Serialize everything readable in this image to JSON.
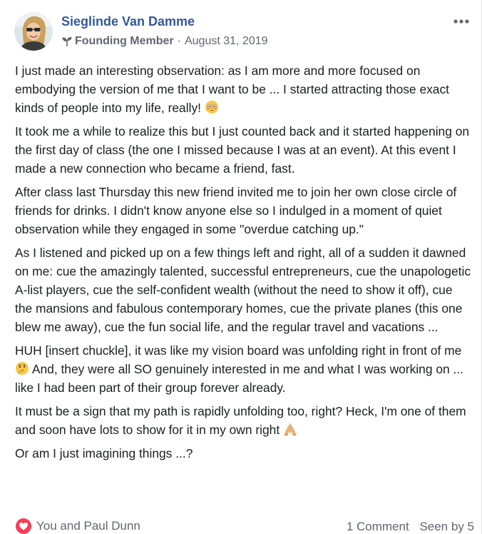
{
  "post": {
    "author": {
      "name": "Sieglinde Van Damme",
      "badge": "Founding Member",
      "date": "August 31, 2019"
    },
    "paragraphs": [
      {
        "text": "I just made an interesting observation: as I am more and more focused on embodying the version of me that I want to be ... I started attracting those exact kinds of people into my life, really! ",
        "emoji": "flushed-face-emoji",
        "after": ""
      },
      {
        "text": "It took me a while to realize this but I just counted back and it started happening on the first day of class (the one I missed because I was at an event). At this event I made a new connection who became a friend, fast.",
        "emoji": "",
        "after": ""
      },
      {
        "text": "After class last Thursday this new friend invited me to join her own close circle of friends for drinks. I didn't know anyone else so I indulged in a moment of quiet observation while they engaged in some \"overdue catching up.\"",
        "emoji": "",
        "after": ""
      },
      {
        "text": "As I listened and picked up on a few things left and right, all of a sudden it dawned on me: cue the amazingly talented, successful entrepreneurs, cue the unapologetic A-list players, cue the self-confident wealth (without the need to show it off), cue the mansions and fabulous contemporary homes, cue the private planes (this one blew me away), cue the fun social life, and the regular travel and vacations ...",
        "emoji": "",
        "after": ""
      },
      {
        "text": "HUH [insert chuckle], it was like my vision board was unfolding right in front of me ",
        "emoji": "thinking-face-emoji",
        "after": " And, they were all SO genuinely interested in me and what I was working on ... like I had been part of their group forever already."
      },
      {
        "text": "It must be a sign that my path is rapidly unfolding too, right? Heck, I'm one of them and soon have lots to show for it in my own right ",
        "emoji": "folded-hands-emoji",
        "after": ""
      },
      {
        "text": "Or am I just imagining things ...?",
        "emoji": "",
        "after": ""
      }
    ],
    "footer": {
      "reactors": "You and Paul Dunn",
      "comments": "1 Comment",
      "seen_by": "Seen by 5"
    },
    "colors": {
      "name": "#365899",
      "meta": "#606770",
      "text": "#1c1e21",
      "love": "#f33e58"
    }
  }
}
